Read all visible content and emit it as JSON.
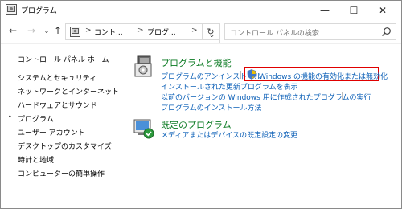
{
  "window": {
    "title": "プログラム",
    "controls": {
      "minimize": "—",
      "maximize": "☐",
      "close": "✕"
    }
  },
  "nav": {
    "back": "←",
    "forward": "→",
    "history": "⌄",
    "up": "↑",
    "breadcrumbs": [
      "コント...",
      "プログ..."
    ],
    "separator": ">",
    "dropdown": "⌄",
    "refresh": "↻",
    "search_placeholder": "コントロール パネルの検索"
  },
  "sidebar": {
    "items": [
      {
        "label": "コントロール パネル ホーム",
        "current": false
      },
      {
        "label": "システムとセキュリティ",
        "current": false
      },
      {
        "label": "ネットワークとインターネット",
        "current": false
      },
      {
        "label": "ハードウェアとサウンド",
        "current": false
      },
      {
        "label": "プログラム",
        "current": true
      },
      {
        "label": "ユーザー アカウント",
        "current": false
      },
      {
        "label": "デスクトップのカスタマイズ",
        "current": false
      },
      {
        "label": "時計と地域",
        "current": false
      },
      {
        "label": "コンピューターの簡単操作",
        "current": false
      }
    ],
    "bullet": "•"
  },
  "main": {
    "programs": {
      "title": "プログラムと機能",
      "links": [
        "プログラムのアンインストール",
        "Windows の機能の有効化または無効化",
        "インストールされた更新プログラムを表示",
        "以前のバージョンの Windows 用に作成されたプログラムの実行",
        "プログラムのインストール方法"
      ]
    },
    "defaults": {
      "title": "既定のプログラム",
      "links": [
        "メディアまたはデバイスの既定設定の変更"
      ]
    }
  },
  "colors": {
    "link": "#0b5fb7",
    "category_title": "#0a7a22",
    "highlight_border": "#e00000"
  }
}
